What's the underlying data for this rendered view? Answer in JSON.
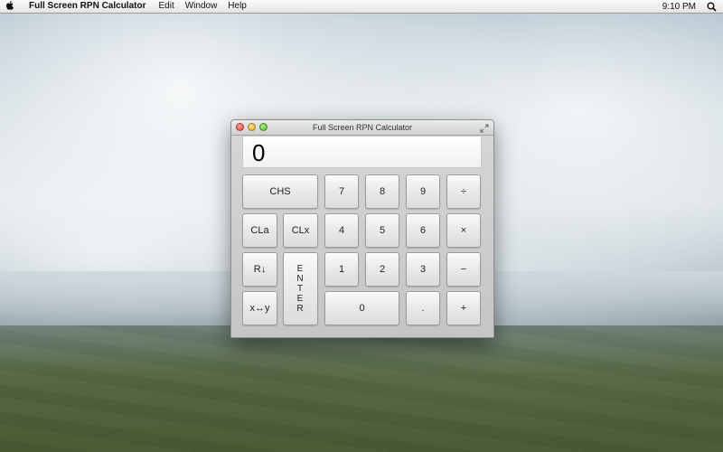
{
  "menubar": {
    "app_name": "Full Screen RPN Calculator",
    "items": [
      "Edit",
      "Window",
      "Help"
    ],
    "clock": "9:10 PM"
  },
  "window": {
    "title": "Full Screen RPN Calculator",
    "display_value": "0"
  },
  "keys": {
    "chs": "CHS",
    "seven": "7",
    "eight": "8",
    "nine": "9",
    "divide": "÷",
    "cla": "CLa",
    "clx": "CLx",
    "four": "4",
    "five": "5",
    "six": "6",
    "multiply": "×",
    "roll_down": "R↓",
    "one": "1",
    "two": "2",
    "three": "3",
    "minus": "−",
    "swap": "x↔y",
    "enter_letters": [
      "E",
      "N",
      "T",
      "E",
      "R"
    ],
    "zero": "0",
    "decimal": ".",
    "plus": "+"
  }
}
